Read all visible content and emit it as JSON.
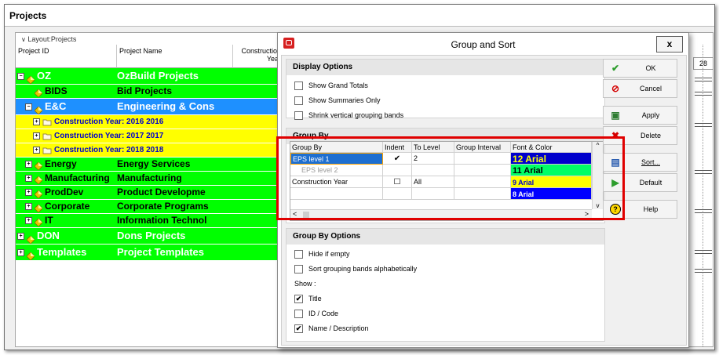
{
  "window": {
    "title": "Projects"
  },
  "layout_label": "Layout:Projects",
  "columns": {
    "project_id": "Project ID",
    "project_name": "Project Name",
    "construction": "Construction",
    "year": "Year"
  },
  "right_grid": {
    "tick": "28"
  },
  "rows": [
    {
      "id": "OZ",
      "name": "OzBuild Projects",
      "bg": "#00ff00",
      "fg": "#ffffff",
      "namefg": "#ffffff",
      "level": 0,
      "expander": "−",
      "icon": "diamond",
      "tall": true
    },
    {
      "id": "BIDS",
      "name": "Bid Projects",
      "bg": "#00ff00",
      "fg": "#000000",
      "namefg": "#000000",
      "level": 1,
      "expander": "",
      "icon": "diamond",
      "tall": false
    },
    {
      "id": "E&C",
      "name": "Engineering & Cons",
      "bg": "#1e90ff",
      "fg": "#ffffff",
      "namefg": "#ffffff",
      "level": 1,
      "expander": "−",
      "icon": "diamond",
      "tall": true
    },
    {
      "id": "Construction Year: 2016  2016",
      "name": "",
      "bg": "#ffff00",
      "fg": "#0000cc",
      "namefg": "#0000cc",
      "level": 2,
      "expander": "+",
      "icon": "folder",
      "tall": false,
      "span": true
    },
    {
      "id": "Construction Year: 2017  2017",
      "name": "",
      "bg": "#ffff00",
      "fg": "#0000cc",
      "namefg": "#0000cc",
      "level": 2,
      "expander": "+",
      "icon": "folder",
      "tall": false,
      "span": true
    },
    {
      "id": "Construction Year: 2018  2018",
      "name": "",
      "bg": "#ffff00",
      "fg": "#0000cc",
      "namefg": "#0000cc",
      "level": 2,
      "expander": "+",
      "icon": "folder",
      "tall": false,
      "span": true
    },
    {
      "id": "Energy",
      "name": "Energy Services",
      "bg": "#00ff00",
      "fg": "#000000",
      "namefg": "#000000",
      "level": 1,
      "expander": "+",
      "icon": "diamond",
      "tall": false
    },
    {
      "id": "Manufacturing",
      "name": "Manufacturing",
      "bg": "#00ff00",
      "fg": "#000000",
      "namefg": "#000000",
      "level": 1,
      "expander": "+",
      "icon": "diamond",
      "tall": false
    },
    {
      "id": "ProdDev",
      "name": "Product Developme",
      "bg": "#00ff00",
      "fg": "#000000",
      "namefg": "#000000",
      "level": 1,
      "expander": "+",
      "icon": "diamond",
      "tall": false
    },
    {
      "id": "Corporate",
      "name": "Corporate Programs",
      "bg": "#00ff00",
      "fg": "#000000",
      "namefg": "#000000",
      "level": 1,
      "expander": "+",
      "icon": "diamond",
      "tall": false
    },
    {
      "id": "IT",
      "name": "Information Technol",
      "bg": "#00ff00",
      "fg": "#000000",
      "namefg": "#000000",
      "level": 1,
      "expander": "+",
      "icon": "diamond",
      "tall": false
    },
    {
      "id": "DON",
      "name": "Dons Projects",
      "bg": "#00ff00",
      "fg": "#ffffff",
      "namefg": "#ffffff",
      "level": 0,
      "expander": "+",
      "icon": "diamond",
      "tall": true
    },
    {
      "id": "Templates",
      "name": "Project Templates",
      "bg": "#00ff00",
      "fg": "#ffffff",
      "namefg": "#ffffff",
      "level": 0,
      "expander": "+",
      "icon": "diamond",
      "tall": true
    }
  ],
  "dialog": {
    "title": "Group and Sort",
    "close_label": "x",
    "display_options": {
      "heading": "Display Options",
      "items": [
        {
          "label": "Show Grand Totals",
          "checked": false
        },
        {
          "label": "Show Summaries Only",
          "checked": false
        },
        {
          "label": "Shrink vertical grouping bands",
          "checked": false
        }
      ]
    },
    "group_by": {
      "heading": "Group By",
      "headers": [
        "Group By",
        "Indent",
        "To Level",
        "Group Interval",
        "Font & Color"
      ],
      "rows": [
        {
          "group": "EPS level 1",
          "indent": "✔",
          "to_level": "2",
          "interval": "",
          "font": "12 Arial",
          "font_bg": "#0000cc",
          "font_fg": "#ffff00",
          "selected": true
        },
        {
          "group": "EPS level 2",
          "indent": "",
          "to_level": "",
          "interval": "",
          "font": "11 Arial",
          "font_bg": "#00ff66",
          "font_fg": "#000000",
          "selected": false,
          "dim": true
        },
        {
          "group": "Construction Year",
          "indent": "☐",
          "to_level": "All",
          "interval": "",
          "font": "9 Arial",
          "font_bg": "#ffff00",
          "font_fg": "#0000cc",
          "selected": false
        },
        {
          "group": "",
          "indent": "",
          "to_level": "",
          "interval": "",
          "font": "8 Arial",
          "font_bg": "#0000ff",
          "font_fg": "#ffffff",
          "selected": false
        }
      ],
      "scroll_left": "<",
      "scroll_right": ">",
      "scroll_up": "^",
      "scroll_down": "v"
    },
    "group_by_options": {
      "heading": "Group By Options",
      "items": [
        {
          "label": "Hide if empty",
          "checked": false
        },
        {
          "label": "Sort grouping bands alphabetically",
          "checked": false
        }
      ],
      "show_label": "Show :",
      "show_items": [
        {
          "label": "Title",
          "checked": true
        },
        {
          "label": "ID / Code",
          "checked": false
        },
        {
          "label": "Name / Description",
          "checked": true
        }
      ]
    },
    "buttons": [
      {
        "label": "OK",
        "icon": "check-icon",
        "glyph": "✔",
        "color": "#2e9e2e"
      },
      {
        "label": "Cancel",
        "icon": "cancel-icon",
        "glyph": "⊘",
        "color": "#d40000"
      },
      {
        "label": "Apply",
        "icon": "apply-icon",
        "glyph": "▣",
        "color": "#2e7d32"
      },
      {
        "label": "Delete",
        "icon": "delete-icon",
        "glyph": "✖",
        "color": "#d40000"
      },
      {
        "label": "Sort...",
        "icon": "sort-icon",
        "glyph": "▤",
        "color": "#2a5db0"
      },
      {
        "label": "Default",
        "icon": "default-icon",
        "glyph": "▶",
        "color": "#2e9e2e"
      },
      {
        "label": "Help",
        "icon": "help-icon",
        "glyph": "?",
        "color": "#000000"
      }
    ]
  }
}
